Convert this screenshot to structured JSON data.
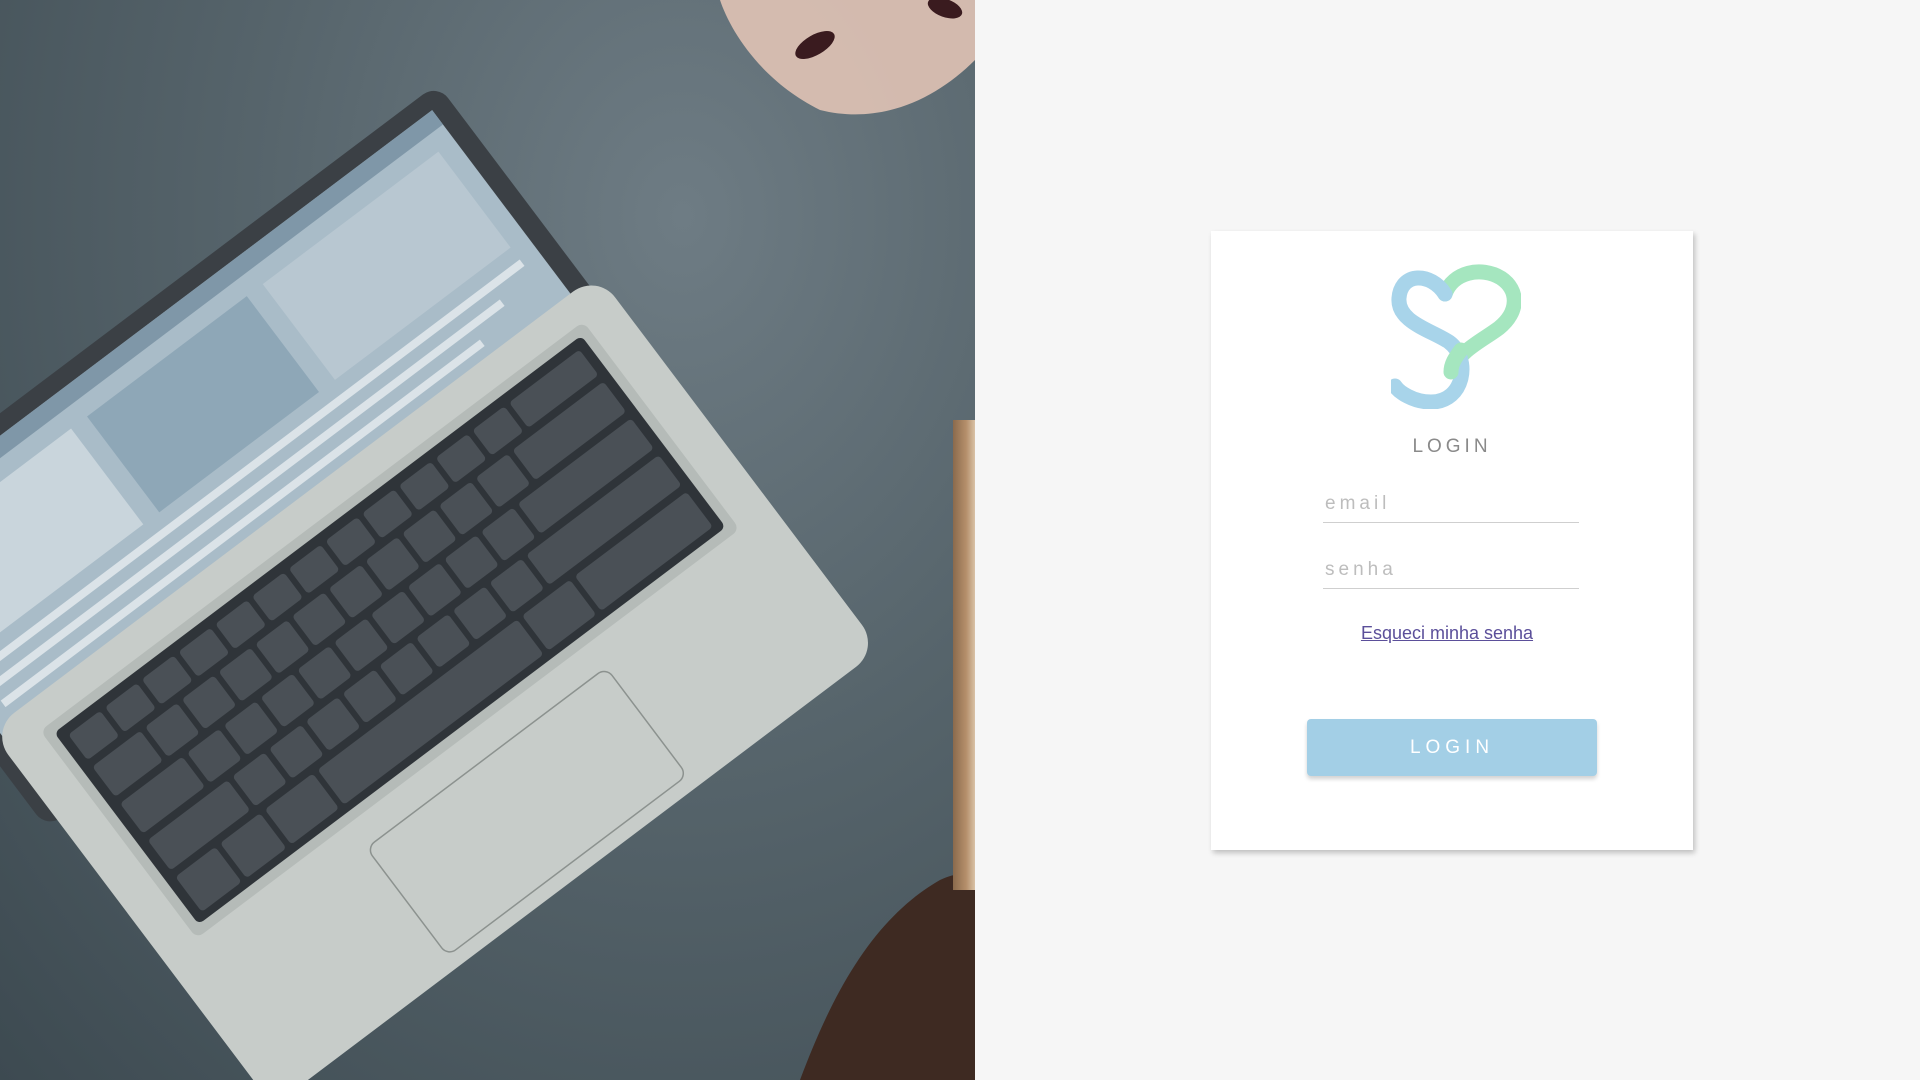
{
  "login": {
    "title": "LOGIN",
    "email_placeholder": "email",
    "password_placeholder": "senha",
    "forgot_password_label": "Esqueci minha senha",
    "submit_label": "LOGIN"
  },
  "colors": {
    "page_background": "#f6f6f6",
    "card_background": "#ffffff",
    "button_background": "#a3cfe6",
    "link_color": "#5b4f9a",
    "logo_blue": "#a8d4ea",
    "logo_green": "#a5e6bf"
  },
  "icons": {
    "logo": "s-heart-logo"
  }
}
